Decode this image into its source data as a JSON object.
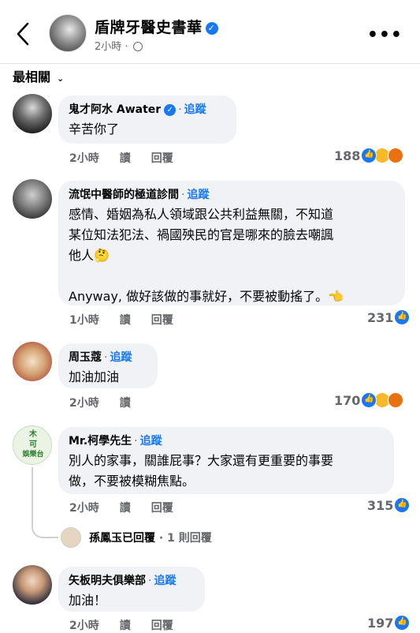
{
  "header": {
    "page_name": "盾牌牙醫史書華",
    "time": "2小時",
    "meta_separator": "·",
    "more_label": "•••"
  },
  "sort_label": "最相關",
  "action_labels": {
    "read": "讀",
    "reply": "回覆"
  },
  "follow_label": "追蹤",
  "comments": [
    {
      "name": "鬼才阿水 Awater",
      "verified": true,
      "text": "辛苦你了",
      "time": "2小時",
      "reactions": "188",
      "reaction_icons": [
        "like-icon",
        "haha-icon",
        "angry-icon"
      ]
    },
    {
      "name": "流氓中醫師的極道診間",
      "verified": false,
      "text": "感情、婚姻為私人領域跟公共利益無關，不知道\n某位知法犯法、禍國殃民的官是哪來的臉去嘲諷\n他人🤔\n\nAnyway, 做好該做的事就好，不要被動搖了。👈",
      "time": "1小時",
      "reactions": "231",
      "reaction_icons": [
        "like-icon"
      ]
    },
    {
      "name": "周玉蔻",
      "verified": false,
      "text": "加油加油",
      "time": "2小時",
      "reactions": "170",
      "reaction_icons": [
        "like-icon",
        "haha-icon",
        "angry-icon"
      ]
    },
    {
      "name": "Mr.柯學先生",
      "verified": false,
      "text": "別人的家事，關誰屁事？大家還有更重要的事要\n做，不要被模糊焦點。",
      "time": "2小時",
      "reactions": "315",
      "reaction_icons": [
        "like-icon"
      ],
      "avatar_text": [
        "木",
        "可",
        "娛樂台"
      ]
    },
    {
      "name": "矢板明夫俱樂部",
      "verified": false,
      "text": "加油！",
      "time": "2小時",
      "reactions": "197",
      "reaction_icons": [
        "like-icon"
      ]
    }
  ],
  "reply_summary": {
    "name": "孫鳳玉已回覆",
    "separator": "·",
    "count": "1 則回覆"
  }
}
